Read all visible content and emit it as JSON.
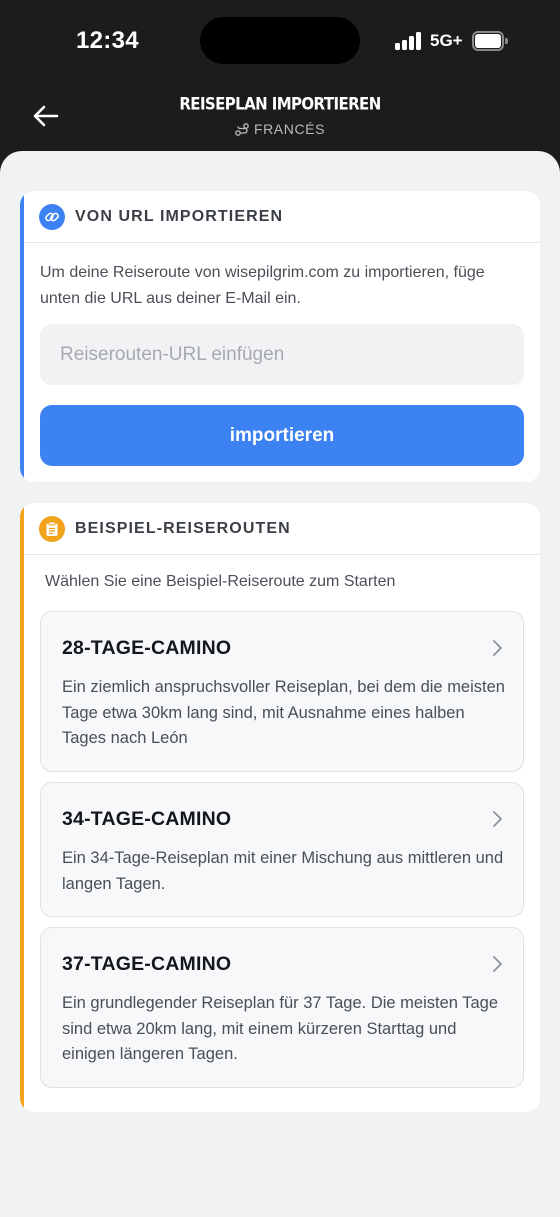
{
  "status_bar": {
    "time": "12:34",
    "network": "5G+"
  },
  "nav": {
    "title": "REISEPLAN IMPORTIEREN",
    "route": "FRANCÉS"
  },
  "import_card": {
    "title": "VON URL IMPORTIEREN",
    "description": "Um deine Reiseroute von wisepilgrim.com zu importieren, füge unten die URL aus deiner E-Mail ein.",
    "url_value": "",
    "url_placeholder": "Reiserouten-URL einfügen",
    "button_label": "importieren"
  },
  "examples_card": {
    "title": "BEISPIEL-REISEROUTEN",
    "subtitle": "Wählen Sie eine Beispiel-Reiseroute zum Starten",
    "items": [
      {
        "title": "28-TAGE-CAMINO",
        "description": "Ein ziemlich anspruchsvoller Reiseplan, bei dem die meisten Tage etwa 30km lang sind, mit Ausnahme eines halben Tages nach León"
      },
      {
        "title": "34-TAGE-CAMINO",
        "description": "Ein 34-Tage-Reiseplan mit einer Mischung aus mittleren und langen Tagen."
      },
      {
        "title": "37-TAGE-CAMINO",
        "description": "Ein grundlegender Reiseplan für 37 Tage. Die meisten Tage sind etwa 20km lang, mit einem kürzeren Starttag und einigen längeren Tagen."
      }
    ]
  },
  "colors": {
    "header_bg": "#1c1c1c",
    "content_bg": "#f1f2f4",
    "import_accent": "#3d82f3",
    "examples_accent": "#f1a31c",
    "button_bg": "#3d82f3"
  },
  "icons": {
    "back": "arrow-left-icon",
    "route": "route-icon",
    "link": "link-icon",
    "clipboard": "clipboard-icon",
    "chevron": "chevron-right-icon"
  }
}
